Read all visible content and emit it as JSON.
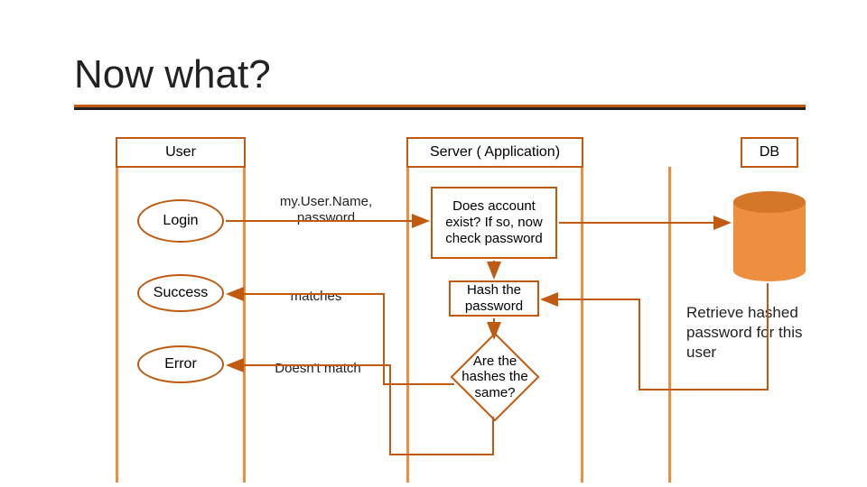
{
  "title": "Now what?",
  "lanes": {
    "user": "User",
    "server": "Server ( Application)",
    "db": "DB"
  },
  "nodes": {
    "login": "Login",
    "credentials": "my.User.Name, password",
    "check_account": "Does account exist?  If so, now check password",
    "hash": "Hash the password",
    "compare": "Are the hashes the same?",
    "success": "Success",
    "error": "Error",
    "matches": "matches",
    "no_match": "Doesn't match"
  },
  "db_annotation": "Retrieve hashed password for this user",
  "colors": {
    "accent": "#c05a11",
    "fill": "#ee8f3f"
  }
}
